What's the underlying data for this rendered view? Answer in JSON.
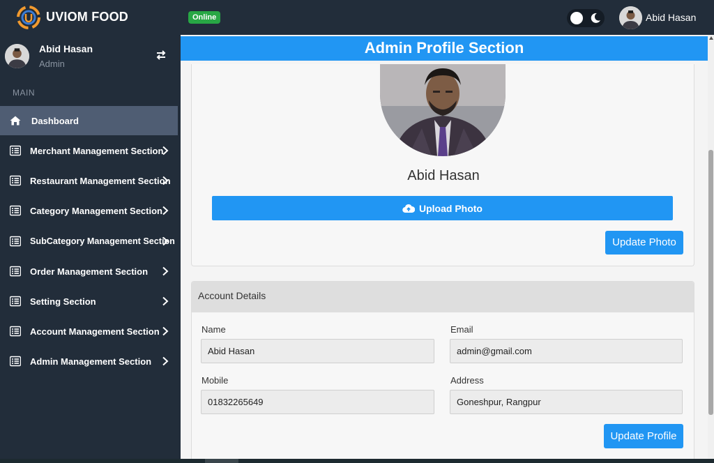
{
  "app": {
    "name": "UVIOM FOOD",
    "status": "Online"
  },
  "topbar": {
    "username": "Abid Hasan"
  },
  "sidebar": {
    "profile": {
      "name": "Abid Hasan",
      "role": "Admin"
    },
    "section_label": "MAIN",
    "items": [
      {
        "label": "Dashboard",
        "icon": "home-icon"
      },
      {
        "label": "Merchant Management Section",
        "icon": "list-icon"
      },
      {
        "label": "Restaurant Management Section",
        "icon": "list-icon"
      },
      {
        "label": "Category Management Section",
        "icon": "list-icon"
      },
      {
        "label": "SubCategory Management Section",
        "icon": "list-icon"
      },
      {
        "label": "Order Management Section",
        "icon": "list-icon"
      },
      {
        "label": "Setting Section",
        "icon": "list-icon"
      },
      {
        "label": "Account Management Section",
        "icon": "list-icon"
      },
      {
        "label": "Admin Management Section",
        "icon": "list-icon"
      }
    ]
  },
  "main": {
    "title": "Admin Profile Section",
    "profile_name": "Abid Hasan",
    "upload_label": "Upload Photo",
    "update_photo_label": "Update Photo",
    "account": {
      "title": "Account Details",
      "name_label": "Name",
      "name_value": "Abid Hasan",
      "email_label": "Email",
      "email_value": "admin@gmail.com",
      "mobile_label": "Mobile",
      "mobile_value": "01832265649",
      "address_label": "Address",
      "address_value": "Goneshpur, Rangpur",
      "update_label": "Update Profile"
    }
  },
  "colors": {
    "accent": "#2196f3",
    "sidebar": "#222d3a",
    "online": "#28a745"
  }
}
